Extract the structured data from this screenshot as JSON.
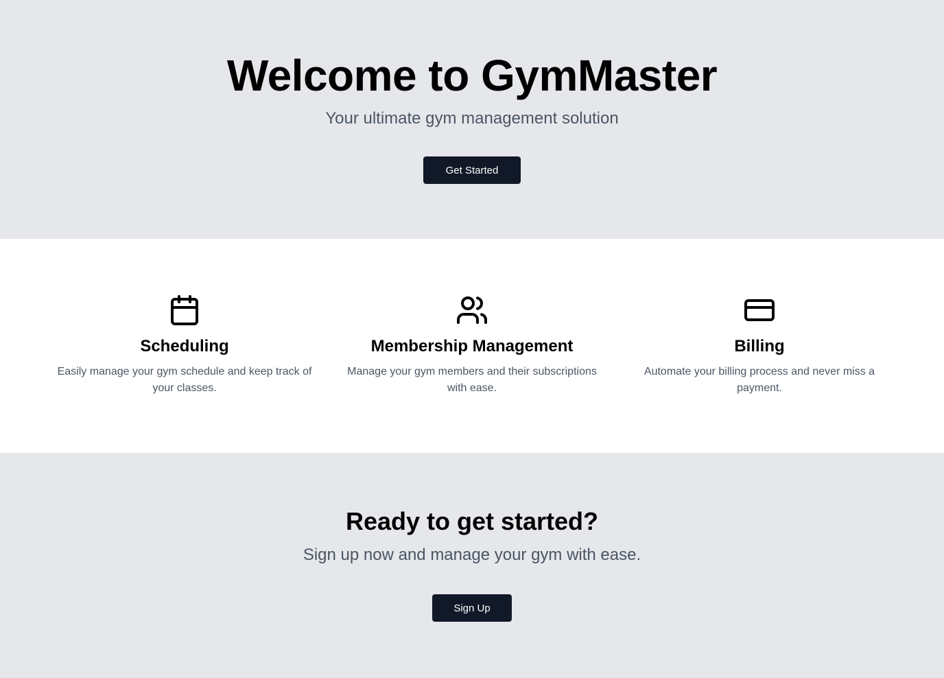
{
  "hero": {
    "title": "Welcome to GymMaster",
    "subtitle": "Your ultimate gym management solution",
    "button_label": "Get Started"
  },
  "features": [
    {
      "icon": "calendar-icon",
      "title": "Scheduling",
      "description": "Easily manage your gym schedule and keep track of your classes."
    },
    {
      "icon": "users-icon",
      "title": "Membership Management",
      "description": "Manage your gym members and their subscriptions with ease."
    },
    {
      "icon": "credit-card-icon",
      "title": "Billing",
      "description": "Automate your billing process and never miss a payment."
    }
  ],
  "cta": {
    "title": "Ready to get started?",
    "subtitle": "Sign up now and manage your gym with ease.",
    "button_label": "Sign Up"
  },
  "colors": {
    "section_gray": "#e5e7eb",
    "button_dark": "#111827",
    "muted_text": "#4b5563"
  }
}
